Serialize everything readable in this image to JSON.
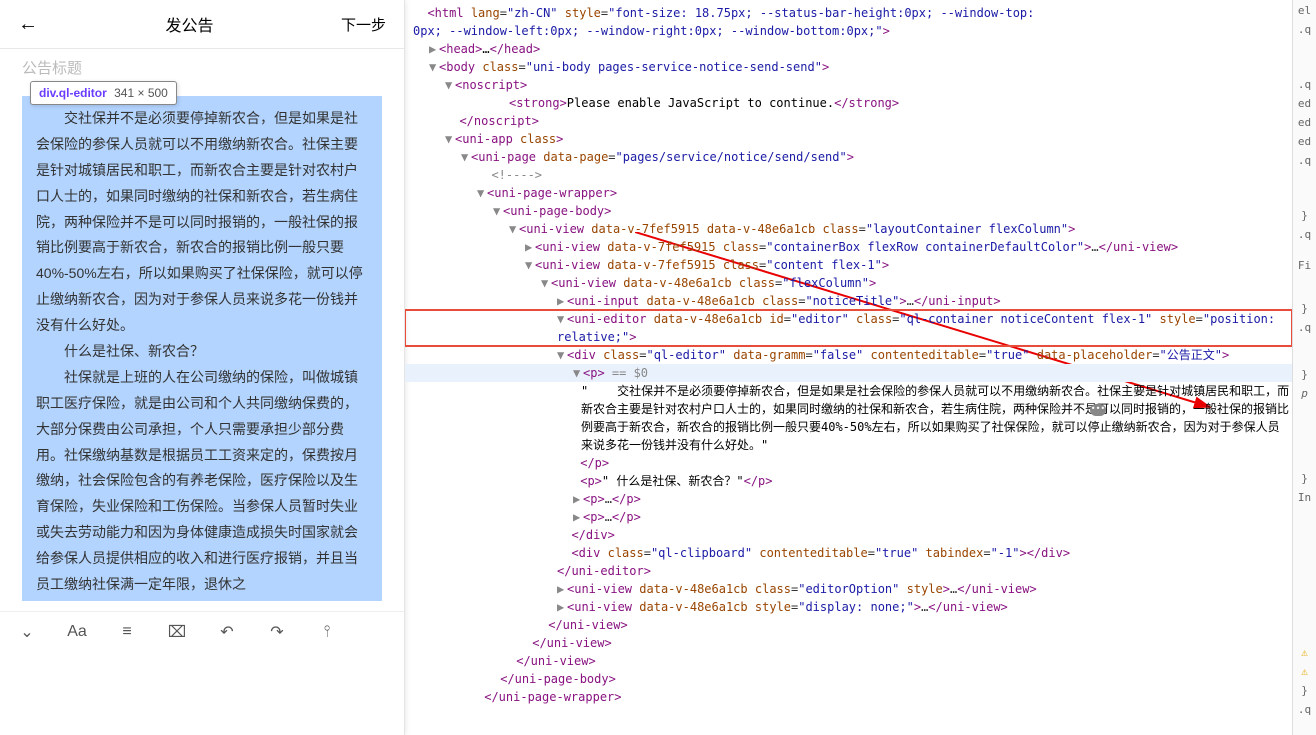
{
  "mobile": {
    "header": {
      "back_glyph": "←",
      "title": "发公告",
      "next": "下一步"
    },
    "title_placeholder": "公告标题",
    "tooltip": {
      "selector": "div.ql-editor",
      "dims": "341 × 500"
    },
    "paragraphs": [
      "交社保并不是必须要停掉新农合，但是如果是社会保险的参保人员就可以不用缴纳新农合。社保主要是针对城镇居民和职工，而新农合主要是针对农村户口人士的，如果同时缴纳的社保和新农合，若生病住院，两种保险并不是可以同时报销的，一般社保的报销比例要高于新农合，新农合的报销比例一般只要40%-50%左右，所以如果购买了社保保险，就可以停止缴纳新农合，因为对于参保人员来说多花一份钱并没有什么好处。",
      "什么是社保、新农合？",
      "社保就是上班的人在公司缴纳的保险，叫做城镇职工医疗保险，就是由公司和个人共同缴纳保费的，大部分保费由公司承担，个人只需要承担少部分费用。社保缴纳基数是根据员工工资来定的，保费按月缴纳，社会保险包含的有养老保险，医疗保险以及生育保险，失业保险和工伤保险。当参保人员暂时失业或失去劳动能力和因为身体健康造成损失时国家就会给参保人员提供相应的收入和进行医疗报销，并且当员工缴纳社保满一定年限，退休之"
    ],
    "toolbar": {
      "chevron": "⌄",
      "font": "Aa",
      "list": "≡",
      "img": "⌧",
      "undo": "↶",
      "redo": "↷",
      "marker": "⫯"
    }
  },
  "dom": {
    "html_open": "<html lang=\"zh-CN\" style=\"font-size: 18.75px; --status-bar-height:0px; --window-top:0px; --window-left:0px; --window-right:0px; --window-bottom:0px;\">",
    "head": {
      "open": "<head>",
      "ellipsis": "…",
      "close": "</head>"
    },
    "body_open": "<body class=\"uni-body pages-service-notice-send-send\">",
    "noscript": {
      "open": "<noscript>",
      "strong": "<strong>Please enable JavaScript to continue.</strong>",
      "close": "</noscript>"
    },
    "uni_app": "<uni-app class>",
    "uni_page": "<uni-page data-page=\"pages/service/notice/send/send\">",
    "comment": "<!---->",
    "wrapper": "<uni-page-wrapper>",
    "page_body": "<uni-page-body>",
    "layout": "<uni-view data-v-7fef5915 data-v-48e6a1cb class=\"layoutContainer flexColumn\">",
    "container_box": "<uni-view data-v-7fef5915 class=\"containerBox flexRow containerDefaultColor\">…</uni-view>",
    "content": "<uni-view data-v-7fef5915 class=\"content flex-1\">",
    "flexcol": "<uni-view data-v-48e6a1cb class=\"flexColumn\">",
    "uni_input": "<uni-input data-v-48e6a1cb class=\"noticeTitle\">…</uni-input>",
    "uni_editor": "<uni-editor data-v-48e6a1cb id=\"editor\" class=\"ql-container noticeContent flex-1\" style=\"position: relative;\">",
    "ql_editor": "<div class=\"ql-editor\" data-gramm=\"false\" contenteditable=\"true\" data-placeholder=\"公告正文\">",
    "p_open": "<p>",
    "p_dollar": " == $0",
    "p_text": "\"    交社保并不是必须要停掉新农合，但是如果是社会保险的参保人员就可以不用缴纳新农合。社保主要是针对城镇居民和职工，而新农合主要是针对农村户口人士的，如果同时缴纳的社保和新农合，若生病住院，两种保险并不是可以同时报销的，一般社保的报销比例要高于新农合，新农合的报销比例一般只要40%-50%左右，所以如果购买了社保保险，就可以停止缴纳新农合，因为对于参保人员来说多花一份钱并没有什么好处。\"",
    "p_close": "</p>",
    "p2": "<p>\" 什么是社保、新农合？\"</p>",
    "p_ellipsis": "<p>…</p>",
    "div_close": "</div>",
    "ql_clipboard": "<div class=\"ql-clipboard\" contenteditable=\"true\" tabindex=\"-1\"></div>",
    "uni_editor_close": "</uni-editor>",
    "editor_option": "<uni-view data-v-48e6a1cb class=\"editorOption\" style>…</uni-view>",
    "display_none": "<uni-view data-v-48e6a1cb style=\"display: none;\">…</uni-view>",
    "uni_view_close": "</uni-view>",
    "uni_page_body_close": "</uni-page-body>",
    "uni_page_wrapper_close": "</uni-page-wrapper>"
  },
  "rail": {
    "items": [
      "el",
      ".q",
      ".q",
      "ed",
      "ed",
      "ed",
      ".q",
      "}",
      ".q",
      "Fi",
      "}",
      ".q",
      "}",
      "p",
      "}",
      "In",
      "}",
      ".q"
    ]
  }
}
